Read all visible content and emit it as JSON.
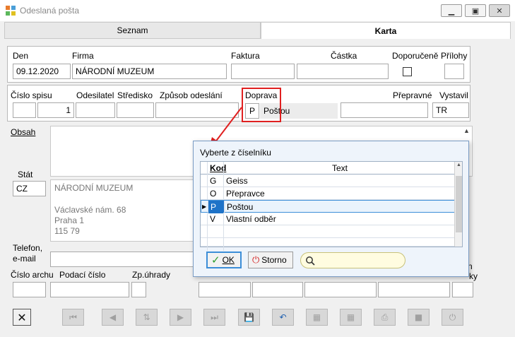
{
  "window": {
    "title": "Odeslaná pošta"
  },
  "tabs": [
    {
      "label": "Seznam",
      "underline_char": "S"
    },
    {
      "label": "Karta"
    }
  ],
  "form": {
    "den_label": "Den",
    "den_value": "09.12.2020",
    "firma_label": "Firma",
    "firma_value": "NÁRODNÍ MUZEUM",
    "faktura_label": "Faktura",
    "faktura_value": "",
    "castka_label": "Částka",
    "castka_value": "",
    "doporucene_label": "Doporučeně",
    "doporucene_checked": false,
    "prilohy_label": "Přílohy",
    "prilohy_value": "",
    "cislo_spisu_label": "Číslo spisu",
    "cislo_spisu_prefix": "",
    "cislo_spisu_value": "1",
    "odesilatel_label": "Odesilatel",
    "odesilatel_value": "",
    "stredisko_label": "Středisko",
    "stredisko_value": "",
    "zpusob_label": "Způsob odeslání",
    "zpusob_value": "",
    "doprava_label": "Doprava",
    "doprava_code": "P",
    "doprava_text": "Poštou",
    "prepravne_label": "Přepravné",
    "prepravne_value": "",
    "vystavil_label": "Vystavil",
    "vystavil_value": "TR",
    "obsah_label": "Obsah",
    "stat_label": "Stát",
    "stat_value": "CZ",
    "address_lines": [
      "NÁRODNÍ MUZEUM",
      "",
      "Václavské nám. 68",
      "Praha 1",
      "115 79"
    ],
    "telefon_label_1": "Telefon,",
    "telefon_label_2": "e-mail",
    "cislo_archu_label": "Číslo archu",
    "podaci_cislo_label": "Podací číslo",
    "zp_uhrady_label": "Zp.úhrady",
    "right_partial_1": "n",
    "right_partial_2": "ky"
  },
  "dialog": {
    "title": "Vyberte z číselníku",
    "col_kod": "Kod",
    "col_text": "Text",
    "rows": [
      {
        "kod": "G",
        "text": "Geiss",
        "selected": false
      },
      {
        "kod": "O",
        "text": "Přepravce",
        "selected": false
      },
      {
        "kod": "P",
        "text": "Poštou",
        "selected": true
      },
      {
        "kod": "V",
        "text": "Vlastní odběr",
        "selected": false
      },
      {
        "kod": "",
        "text": "",
        "selected": false
      },
      {
        "kod": "",
        "text": "",
        "selected": false
      }
    ],
    "ok_label": "OK",
    "storno_label": "Storno",
    "search_value": ""
  },
  "toolbar": {
    "icons": [
      "close-x",
      "first",
      "prev",
      "sort",
      "next",
      "last",
      "save",
      "undo",
      "edit-calc",
      "edit-calc-2",
      "print",
      "stop",
      "power"
    ]
  }
}
